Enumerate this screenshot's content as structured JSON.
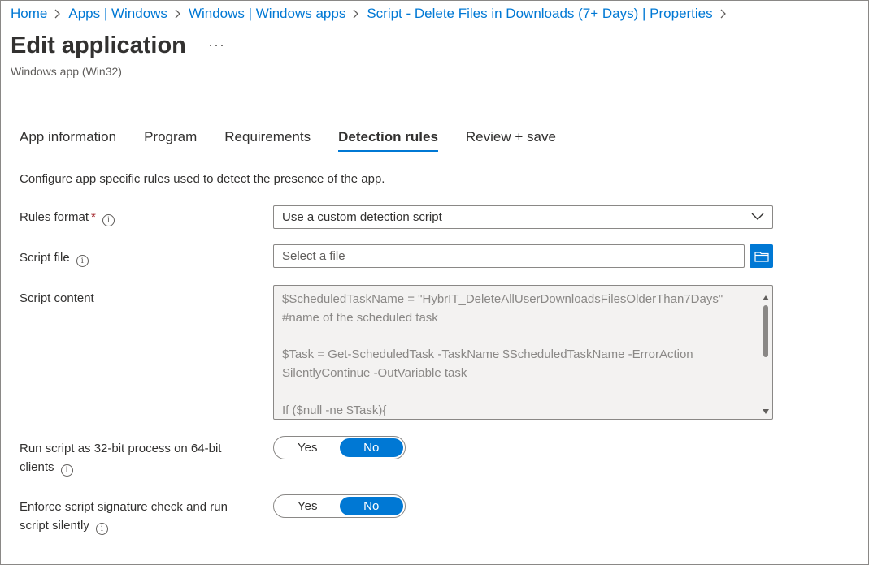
{
  "breadcrumb": {
    "items": [
      "Home",
      "Apps | Windows",
      "Windows | Windows apps",
      "Script - Delete Files in Downloads (7+ Days) | Properties"
    ]
  },
  "page": {
    "title": "Edit application",
    "more": "···",
    "subtitle": "Windows app (Win32)"
  },
  "tabs": [
    {
      "label": "App information",
      "active": false
    },
    {
      "label": "Program",
      "active": false
    },
    {
      "label": "Requirements",
      "active": false
    },
    {
      "label": "Detection rules",
      "active": true
    },
    {
      "label": "Review + save",
      "active": false
    }
  ],
  "description": "Configure app specific rules used to detect the presence of the app.",
  "form": {
    "rules_format": {
      "label": "Rules format",
      "required_mark": "*",
      "value": "Use a custom detection script"
    },
    "script_file": {
      "label": "Script file",
      "placeholder": "Select a file"
    },
    "script_content": {
      "label": "Script content",
      "lines": [
        "$ScheduledTaskName = \"HybrIT_DeleteAllUserDownloadsFilesOlderThan7Days\"",
        "#name of the scheduled task",
        "",
        "$Task = Get-ScheduledTask -TaskName $ScheduledTaskName -ErrorAction",
        "SilentlyContinue -OutVariable task",
        "",
        "If ($null -ne $Task){"
      ]
    },
    "run_32bit": {
      "label_line1": "Run script as 32-bit process on 64-bit",
      "label_line2": "clients",
      "yes": "Yes",
      "no": "No",
      "selected": "No"
    },
    "enforce_signature": {
      "label_line1": "Enforce script signature check and run",
      "label_line2": "script silently",
      "yes": "Yes",
      "no": "No",
      "selected": "No"
    }
  },
  "icons": {
    "info": "i",
    "accent": "#0078d4"
  }
}
